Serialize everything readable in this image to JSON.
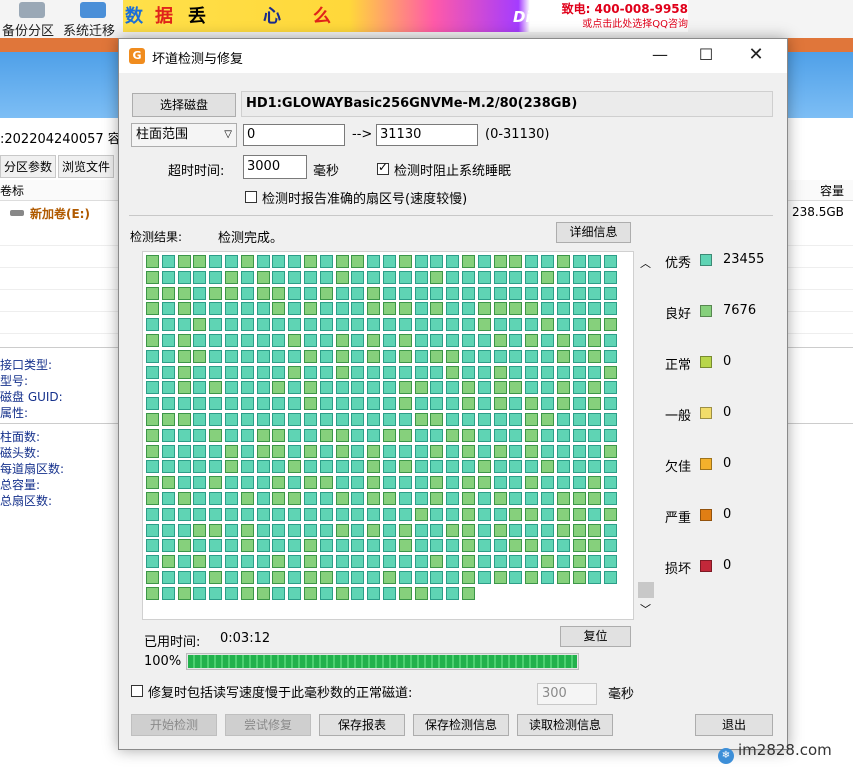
{
  "background": {
    "toolbar": [
      {
        "label": "备份分区",
        "icon": "backup-icon"
      },
      {
        "label": "系统迁移",
        "icon": "computer-icon"
      }
    ],
    "ad": {
      "chars": [
        "数",
        "据",
        "丢",
        "心",
        "么"
      ],
      "brand": "DiskGenius",
      "phone": "致电: 400-008-9958",
      "qq": "或点击此处选择QQ咨询"
    },
    "disk_label": ":202204240057 容",
    "tabs": [
      "分区参数",
      "浏览文件"
    ],
    "column_volume": "卷标",
    "column_capacity": "容量",
    "volume": {
      "name": "新加卷(E:)",
      "capacity": "238.5GB"
    },
    "info_top": [
      "接口类型:",
      "型号:",
      "磁盘 GUID:",
      "属性:"
    ],
    "info_bottom": [
      "柱面数:",
      "磁头数:",
      "每道扇区数:",
      "总容量:",
      "总扇区数:"
    ]
  },
  "dialog": {
    "title": "坏道检测与修复",
    "app_icon": "G",
    "select_disk_button": "选择磁盘",
    "disk_name": "HD1:GLOWAYBasic256GNVMe-M.2/80(238GB)",
    "range_mode": "柱面范围",
    "range_start": "0",
    "range_arrow": "-->",
    "range_end": "31130",
    "range_hint": "(0-31130)",
    "timeout_label": "超时时间:",
    "timeout_value": "3000",
    "timeout_unit": "毫秒",
    "prevent_sleep_label": "检测时阻止系统睡眠",
    "prevent_sleep_checked": true,
    "report_sector_label": "检测时报告准确的扇区号(速度较慢)",
    "report_sector_checked": false,
    "result_label": "检测结果:",
    "result_status": "检测完成。",
    "details_button": "详细信息",
    "legend": [
      {
        "name": "优秀",
        "count": "23455",
        "color": "#5fd4b4"
      },
      {
        "name": "良好",
        "count": "7676",
        "color": "#86d07c"
      },
      {
        "name": "正常",
        "count": "0",
        "color": "#b8d64a"
      },
      {
        "name": "一般",
        "count": "0",
        "color": "#f2dc6a"
      },
      {
        "name": "欠佳",
        "count": "0",
        "color": "#f3b12c"
      },
      {
        "name": "严重",
        "count": "0",
        "color": "#e07e14"
      },
      {
        "name": "损坏",
        "count": "0",
        "color": "#c2283a"
      }
    ],
    "elapsed_label": "已用时间:",
    "elapsed_value": "0:03:12",
    "reset_button": "复位",
    "progress_text": "100%",
    "progress_value": 100,
    "repair_option_label": "修复时包括读写速度慢于此毫秒数的正常磁道:",
    "repair_option_checked": false,
    "repair_delay_value": "300",
    "repair_delay_unit": "毫秒",
    "buttons": {
      "start": "开始检测",
      "try_repair": "尝试修复",
      "save_report": "保存报表",
      "save_info": "保存检测信息",
      "load_info": "读取检测信息",
      "exit": "退出"
    }
  },
  "watermark": "im2828.com"
}
